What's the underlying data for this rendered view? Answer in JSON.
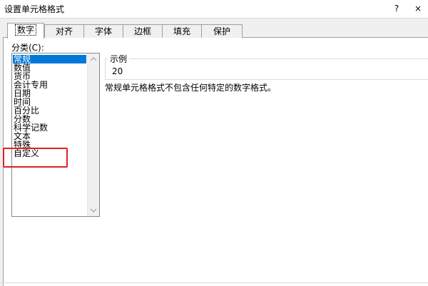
{
  "window": {
    "title": "设置单元格格式",
    "help": "?",
    "close": "×"
  },
  "tabs": [
    {
      "label": "数字"
    },
    {
      "label": "对齐"
    },
    {
      "label": "字体"
    },
    {
      "label": "边框"
    },
    {
      "label": "填充"
    },
    {
      "label": "保护"
    }
  ],
  "category": {
    "label": "分类(C):",
    "items": [
      "常规",
      "数值",
      "货币",
      "会计专用",
      "日期",
      "时间",
      "百分比",
      "分数",
      "科学记数",
      "文本",
      "特殊",
      "自定义"
    ],
    "selected_index": 0
  },
  "sample": {
    "legend": "示例",
    "value": "20"
  },
  "description": "常规单元格格式不包含任何特定的数字格式。",
  "colors": {
    "selection": "#0078d7",
    "highlight_box": "#e02020"
  },
  "icons": {
    "scroll_up": "chevron-up-icon",
    "scroll_down": "chevron-down-icon"
  }
}
